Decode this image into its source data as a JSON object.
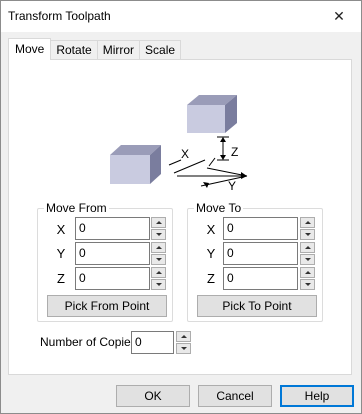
{
  "window": {
    "title": "Transform Toolpath"
  },
  "tabs": [
    {
      "label": "Move",
      "active": true
    },
    {
      "label": "Rotate",
      "active": false
    },
    {
      "label": "Mirror",
      "active": false
    },
    {
      "label": "Scale",
      "active": false
    }
  ],
  "diagram": {
    "x_label": "X",
    "y_label": "Y",
    "z_label": "Z"
  },
  "move_from": {
    "legend": "Move From",
    "x_label": "X",
    "x_value": "0",
    "y_label": "Y",
    "y_value": "0",
    "z_label": "Z",
    "z_value": "0",
    "pick_button": "Pick From Point"
  },
  "move_to": {
    "legend": "Move To",
    "x_label": "X",
    "x_value": "0",
    "y_label": "Y",
    "y_value": "0",
    "z_label": "Z",
    "z_value": "0",
    "pick_button": "Pick To Point"
  },
  "copies": {
    "label": "Number of Copies",
    "value": "0"
  },
  "footer": {
    "ok": "OK",
    "cancel": "Cancel",
    "help": "Help"
  },
  "colors": {
    "accent": "#0078d7",
    "box_front": "#c9cbe0",
    "box_top": "#9a9cb8",
    "box_side": "#7a7d9e"
  }
}
